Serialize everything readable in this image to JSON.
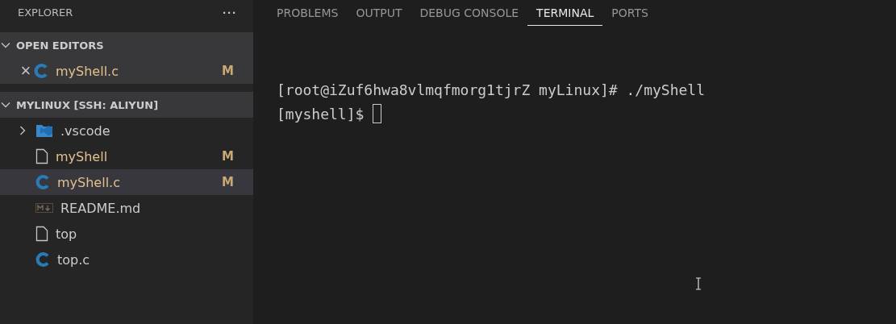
{
  "sidebar": {
    "title": "EXPLORER",
    "more": "···",
    "open_editors": {
      "title": "OPEN EDITORS",
      "expanded": true,
      "items": [
        {
          "name": "myShell.c",
          "kind": "c",
          "modified": true,
          "badge": "M",
          "close": "×"
        }
      ]
    },
    "folder": {
      "title": "MYLINUX [SSH: ALIYUN]",
      "expanded": true,
      "children": [
        {
          "name": ".vscode",
          "kind": "folder",
          "expanded": false,
          "selected": false,
          "modified": false
        },
        {
          "name": "myShell",
          "kind": "file",
          "selected": false,
          "modified": true,
          "badge": "M"
        },
        {
          "name": "myShell.c",
          "kind": "c",
          "selected": true,
          "modified": true,
          "badge": "M"
        },
        {
          "name": "README.md",
          "kind": "md",
          "selected": false,
          "modified": false
        },
        {
          "name": "top",
          "kind": "file",
          "selected": false,
          "modified": false
        },
        {
          "name": "top.c",
          "kind": "c",
          "selected": false,
          "modified": false
        }
      ]
    }
  },
  "panel": {
    "tabs": [
      {
        "label": "PROBLEMS",
        "selected": false
      },
      {
        "label": "OUTPUT",
        "selected": false
      },
      {
        "label": "DEBUG CONSOLE",
        "selected": false
      },
      {
        "label": "TERMINAL",
        "selected": true
      },
      {
        "label": "PORTS",
        "selected": false
      }
    ],
    "terminal": {
      "lines": [
        "[root@iZuf6hwa8vlmqfmorg1tjrZ myLinux]# ./myShell",
        "[myshell]$ "
      ],
      "cursor": true
    }
  }
}
